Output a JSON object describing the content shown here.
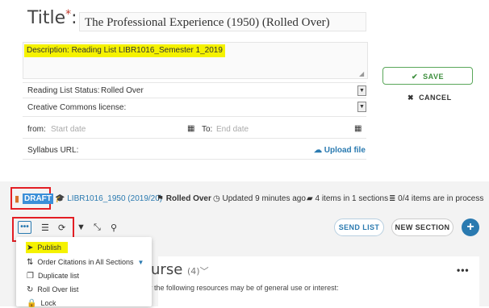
{
  "form": {
    "title_label": "Title",
    "title_star": "*",
    "title_value": "The Professional Experience (1950) (Rolled Over)",
    "description": "Description:   Reading List LIBR1016_Semester 1_2019",
    "status_label": "Reading List Status:",
    "status_value": "Rolled Over",
    "cc_label": "Creative Commons license:",
    "from_label": "from:",
    "from_placeholder": "Start date",
    "to_label": "To:",
    "to_placeholder": "End date",
    "syllabus_label": "Syllabus URL:",
    "upload_label": "Upload file"
  },
  "actions": {
    "save": "SAVE",
    "cancel": "CANCEL"
  },
  "status_bar": {
    "draft": "DRAFT",
    "course": "LIBR1016_1950 (2019/20)",
    "rolled_over": "Rolled Over",
    "updated": "Updated 9 minutes ago",
    "items": "4 items in 1 sections",
    "process": "0/4 items are in process"
  },
  "toolbar": {
    "send_list": "SEND LIST",
    "new_section": "NEW SECTION"
  },
  "menu": {
    "publish": "Publish",
    "order": "Order Citations in All Sections",
    "duplicate": "Duplicate list",
    "rollover": "Roll Over list",
    "lock": "Lock"
  },
  "section": {
    "title": "ourse",
    "count": "(4)",
    "text": "ver the following resources may be of general use or interest:"
  },
  "colors": {
    "highlight": "#f5f200",
    "annotation_red": "#e31e24",
    "save_green": "#3e8f3e",
    "link_blue": "#2a7ab0"
  }
}
